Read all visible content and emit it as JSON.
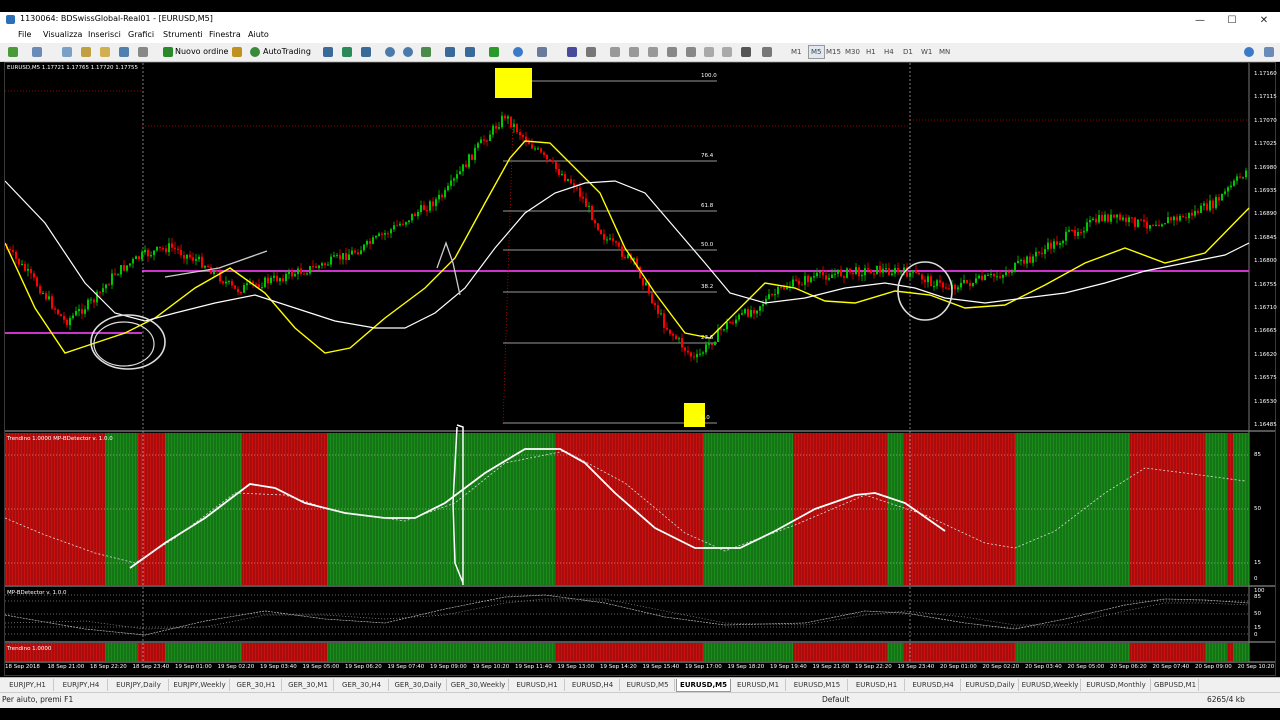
{
  "window": {
    "title": "1130064: BDSwissGlobal-Real01 - [EURUSD,M5]",
    "controls": [
      "—",
      "☐",
      "✕"
    ]
  },
  "menu": [
    "File",
    "Visualizza",
    "Inserisci",
    "Grafici",
    "Strumenti",
    "Finestra",
    "Aiuto"
  ],
  "toolbar": {
    "new_order": "Nuovo ordine",
    "autotrading": "AutoTrading",
    "timeframes": [
      "M1",
      "M5",
      "M15",
      "M30",
      "H1",
      "H4",
      "D1",
      "W1",
      "MN"
    ],
    "active_timeframe": "M5"
  },
  "chart": {
    "symbol_info": "EURUSD,M5  1.17721 1.17765 1.17720 1.17755",
    "price_labels": [
      "1.17160",
      "1.17115",
      "1.17070",
      "1.17025",
      "1.16980",
      "1.16935",
      "1.16890",
      "1.16845",
      "1.16800",
      "1.16755",
      "1.16710",
      "1.16665",
      "1.16620",
      "1.16575",
      "1.16530",
      "1.16485"
    ],
    "fib_levels": [
      "100.0",
      "76.4",
      "61.8",
      "50.0",
      "38.2",
      "23.6",
      "0.0"
    ],
    "indicator1_label": "Trendino 1.0000  MP-BDetector v. 1.0.0",
    "indicator1_scale": [
      "85",
      "50",
      "15",
      "0"
    ],
    "indicator2_label": "MP-BDetector v. 1.0.0",
    "indicator2_scale": [
      "100",
      "85",
      "50",
      "15",
      "0"
    ],
    "indicator3_label": "Trendino 1.0000",
    "time_labels": [
      "18 Sep 2018",
      "18 Sep 21:00",
      "18 Sep 22:20",
      "18 Sep 23:40",
      "19 Sep 01:00",
      "19 Sep 02:20",
      "19 Sep 03:40",
      "19 Sep 05:00",
      "19 Sep 06:20",
      "19 Sep 07:40",
      "19 Sep 09:00",
      "19 Sep 10:20",
      "19 Sep 11:40",
      "19 Sep 13:00",
      "19 Sep 14:20",
      "19 Sep 15:40",
      "19 Sep 17:00",
      "19 Sep 18:20",
      "19 Sep 19:40",
      "19 Sep 21:00",
      "19 Sep 22:20",
      "19 Sep 23:40",
      "20 Sep 01:00",
      "20 Sep 02:20",
      "20 Sep 03:40",
      "20 Sep 05:00",
      "20 Sep 06:20",
      "20 Sep 07:40",
      "20 Sep 09:00",
      "20 Sep 10:20"
    ],
    "colors": {
      "bull": "#00c800",
      "bear": "#ff0000",
      "ma_fast": "#ffff00",
      "ma_slow": "#ffffff",
      "level_line": "#cc33cc",
      "green_zone": "#1a8c1a",
      "red_zone": "#cc1010"
    }
  },
  "tabs": [
    "EURJPY,H1",
    "EURJPY,H4",
    "EURJPY,Daily",
    "EURJPY,Weekly",
    "GER_30,H1",
    "GER_30,M1",
    "GER_30,H4",
    "GER_30,Daily",
    "GER_30,Weekly",
    "EURUSD,H1",
    "EURUSD,H4",
    "EURUSD,M5",
    "EURUSD,M5",
    "EURUSD,M1",
    "EURUSD,M15",
    "EURUSD,H1",
    "EURUSD,H4",
    "EURUSD,Daily",
    "EURUSD,Weekly",
    "EURUSD,Monthly",
    "GBPUSD,M1"
  ],
  "active_tab": 12,
  "status": {
    "help": "Per aiuto, premi F1",
    "profile": "Default",
    "traffic": "6265/4 kb"
  }
}
